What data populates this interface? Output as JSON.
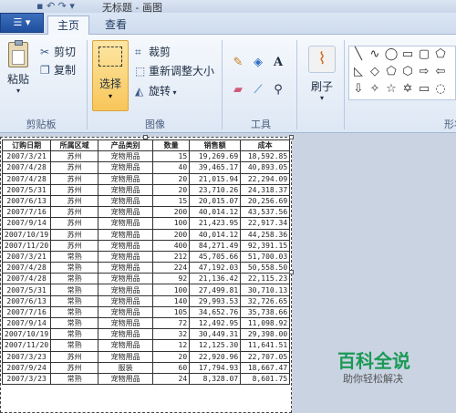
{
  "titlebar": {
    "title": "无标题 - 画图"
  },
  "tabs": [
    {
      "label": "主页",
      "active": true
    },
    {
      "label": "查看",
      "active": false
    }
  ],
  "clipboard": {
    "paste_label": "粘贴",
    "cut_label": "剪切",
    "copy_label": "复制",
    "group_label": "剪贴板"
  },
  "image": {
    "select_label": "选择",
    "crop_label": "裁剪",
    "resize_label": "重新调整大小",
    "rotate_label": "旋转",
    "group_label": "图像"
  },
  "tools": {
    "group_label": "工具"
  },
  "brush": {
    "label": "刷子"
  },
  "shapes": {
    "group_label": "形状"
  },
  "table": {
    "headers": [
      "订购日期",
      "所属区域",
      "产品类别",
      "数量",
      "销售额",
      "成本"
    ],
    "rows": [
      [
        "2007/3/21",
        "苏州",
        "宠物用品",
        "15",
        "19,269.69",
        "18,592.85"
      ],
      [
        "2007/4/28",
        "苏州",
        "宠物用品",
        "40",
        "39,465.17",
        "40,893.05"
      ],
      [
        "2007/4/28",
        "苏州",
        "宠物用品",
        "20",
        "21,015.94",
        "22,294.09"
      ],
      [
        "2007/5/31",
        "苏州",
        "宠物用品",
        "20",
        "23,710.26",
        "24,318.37"
      ],
      [
        "2007/6/13",
        "苏州",
        "宠物用品",
        "15",
        "20,015.07",
        "20,256.69"
      ],
      [
        "2007/7/16",
        "苏州",
        "宠物用品",
        "200",
        "40,014.12",
        "43,537.56"
      ],
      [
        "2007/9/14",
        "苏州",
        "宠物用品",
        "100",
        "21,423.95",
        "22,917.34"
      ],
      [
        "2007/10/19",
        "苏州",
        "宠物用品",
        "200",
        "40,014.12",
        "44,258.36"
      ],
      [
        "2007/11/20",
        "苏州",
        "宠物用品",
        "400",
        "84,271.49",
        "92,391.15"
      ],
      [
        "2007/3/21",
        "常熟",
        "宠物用品",
        "212",
        "45,705.66",
        "51,700.03"
      ],
      [
        "2007/4/28",
        "常熟",
        "宠物用品",
        "224",
        "47,192.03",
        "50,558.50"
      ],
      [
        "2007/4/28",
        "常熟",
        "宠物用品",
        "92",
        "21,136.42",
        "22,115.23"
      ],
      [
        "2007/5/31",
        "常熟",
        "宠物用品",
        "100",
        "27,499.81",
        "30,710.13"
      ],
      [
        "2007/6/13",
        "常熟",
        "宠物用品",
        "140",
        "29,993.53",
        "32,726.65"
      ],
      [
        "2007/7/16",
        "常熟",
        "宠物用品",
        "105",
        "34,652.76",
        "35,738.66"
      ],
      [
        "2007/9/14",
        "常熟",
        "宠物用品",
        "72",
        "12,492.95",
        "11,098.92"
      ],
      [
        "2007/10/19",
        "常熟",
        "宠物用品",
        "32",
        "30,449.31",
        "29,398.00"
      ],
      [
        "2007/11/20",
        "常熟",
        "宠物用品",
        "12",
        "12,125.30",
        "11,641.51"
      ],
      [
        "2007/3/23",
        "苏州",
        "宠物用品",
        "20",
        "22,920.96",
        "22,707.05"
      ],
      [
        "2007/9/24",
        "苏州",
        "服装",
        "60",
        "17,794.93",
        "18,667.47"
      ],
      [
        "2007/3/23",
        "常熟",
        "宠物用品",
        "24",
        "8,328.07",
        "8,601.75"
      ]
    ]
  },
  "watermark": {
    "main": "百科全说",
    "sub": "助你轻松解决"
  },
  "colors": {
    "accent": "#f8c65a",
    "watermark": "#1a9a55"
  }
}
